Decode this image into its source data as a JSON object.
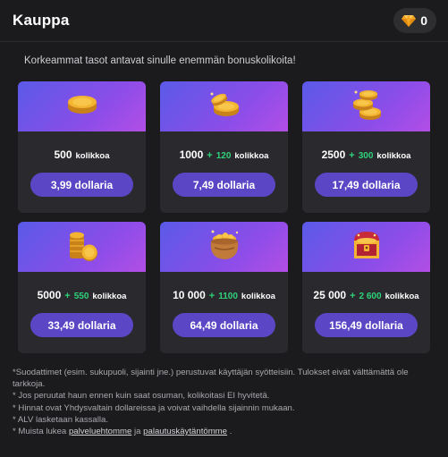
{
  "header": {
    "title": "Kauppa",
    "gems": "0"
  },
  "subtitle": "Korkeammat tasot antavat sinulle enemmän bonuskolikoita!",
  "packages": [
    {
      "icon": "single-coin-icon",
      "amount": "500",
      "plus": "",
      "bonus": "",
      "unit": "kolikkoa",
      "price": "3,99 dollaria"
    },
    {
      "icon": "two-coins-icon",
      "amount": "1000",
      "plus": "+",
      "bonus": "120",
      "unit": "kolikkoa",
      "price": "7,49 dollaria"
    },
    {
      "icon": "coin-stack-icon",
      "amount": "2500",
      "plus": "+",
      "bonus": "300",
      "unit": "kolikkoa",
      "price": "17,49 dollaria"
    },
    {
      "icon": "coin-pile-icon",
      "amount": "5000",
      "plus": "+",
      "bonus": "550",
      "unit": "kolikkoa",
      "price": "33,49 dollaria"
    },
    {
      "icon": "coin-pot-icon",
      "amount": "10 000",
      "plus": "+",
      "bonus": "1100",
      "unit": "kolikkoa",
      "price": "64,49 dollaria"
    },
    {
      "icon": "treasure-chest-icon",
      "amount": "25 000",
      "plus": "+",
      "bonus": "2 600",
      "unit": "kolikkoa",
      "price": "156,49 dollaria"
    }
  ],
  "footer": {
    "line1": "*Suodattimet (esim. sukupuoli, sijainti jne.) perustuvat käyttäjän syötteisiin. Tulokset eivät välttämättä ole tarkkoja.",
    "line2": "* Jos peruutat haun ennen kuin saat osuman, kolikoitasi EI hyvitetä.",
    "line3": "* Hinnat ovat Yhdysvaltain dollareissa ja voivat vaihdella sijainnin mukaan.",
    "line4": "* ALV lasketaan kassalla.",
    "line5_prefix": "* Muista lukea",
    "terms_link": "palveluehtomme",
    "line5_mid": "ja",
    "refund_link": "palautuskäytäntömme",
    "line5_suffix": "."
  },
  "colors": {
    "background": "#1b1b1d",
    "card": "#2a2a2e",
    "button": "#5b46c6",
    "bonus_green": "#2fd27a",
    "gem": "#f5a623"
  }
}
